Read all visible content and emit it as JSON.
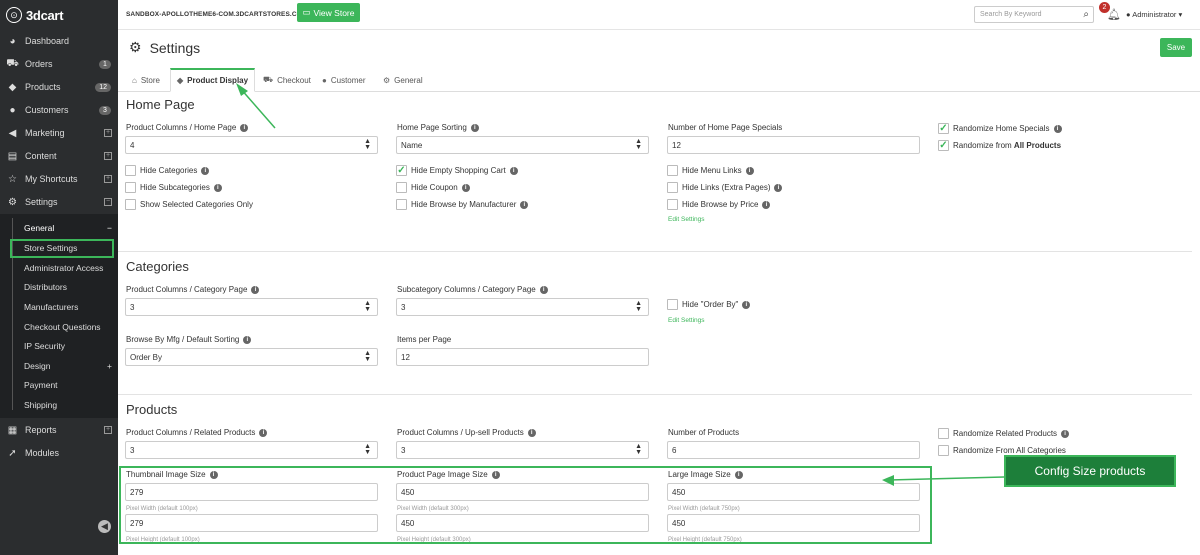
{
  "sidebar": {
    "logo_text": "3dcart",
    "items": [
      {
        "label": "Dashboard",
        "icon": "palette-icon"
      },
      {
        "label": "Orders",
        "icon": "cart-icon",
        "badge": "1"
      },
      {
        "label": "Products",
        "icon": "tag-icon",
        "badge": "12"
      },
      {
        "label": "Customers",
        "icon": "user-icon",
        "badge": "3"
      },
      {
        "label": "Marketing",
        "icon": "megaphone-icon"
      },
      {
        "label": "Content",
        "icon": "document-icon"
      },
      {
        "label": "My Shortcuts",
        "icon": "star-icon"
      },
      {
        "label": "Settings",
        "icon": "gear-icon"
      }
    ],
    "settings_sub": [
      "General",
      "Store Settings",
      "Administrator Access",
      "Distributors",
      "Manufacturers",
      "Checkout Questions",
      "IP Security",
      "Design",
      "Payment",
      "Shipping"
    ],
    "bottom_items": [
      {
        "label": "Reports",
        "icon": "chart-icon"
      },
      {
        "label": "Modules",
        "icon": "rocket-icon"
      }
    ]
  },
  "topbar": {
    "store_url": "SANDBOX-APOLLOTHEME6-COM.3DCARTSTORES.COM",
    "view_store": "View Store",
    "search_placeholder": "Search By Keyword",
    "notifications": "2",
    "user": "Administrator"
  },
  "page": {
    "title": "Settings",
    "save": "Save"
  },
  "tabs": [
    "Store",
    "Product Display",
    "Checkout",
    "Customer",
    "General"
  ],
  "home": {
    "title": "Home Page",
    "product_columns_label": "Product Columns / Home Page",
    "product_columns_value": "4",
    "sorting_label": "Home Page Sorting",
    "sorting_value": "Name",
    "specials_label": "Number of Home Page Specials",
    "specials_value": "12",
    "randomize_specials": "Randomize Home Specials",
    "randomize_from_prefix": "Randomize from ",
    "randomize_from_bold": "All Products",
    "hide_categories": "Hide Categories",
    "hide_subcategories": "Hide Subcategories",
    "show_selected": "Show Selected Categories Only",
    "hide_empty_cart": "Hide Empty Shopping Cart",
    "hide_coupon": "Hide Coupon",
    "hide_browse_mfr": "Hide Browse by Manufacturer",
    "hide_menu_links": "Hide Menu Links",
    "hide_links_extra": "Hide Links (Extra Pages)",
    "hide_browse_price": "Hide Browse by Price",
    "edit_settings": "Edit Settings"
  },
  "categories": {
    "title": "Categories",
    "cat_columns_label": "Product Columns / Category Page",
    "cat_columns_value": "3",
    "subcat_columns_label": "Subcategory Columns / Category Page",
    "subcat_columns_value": "3",
    "hide_order_by": "Hide \"Order By\"",
    "edit_settings": "Edit Settings",
    "browse_sort_label": "Browse By Mfg / Default Sorting",
    "browse_sort_value": "Order By",
    "items_per_page_label": "Items per Page",
    "items_per_page_value": "12"
  },
  "products": {
    "title": "Products",
    "related_label": "Product Columns / Related Products",
    "related_value": "3",
    "upsell_label": "Product Columns / Up-sell Products",
    "upsell_value": "3",
    "number_label": "Number of Products",
    "number_value": "6",
    "randomize_related": "Randomize Related Products",
    "randomize_all": "Randomize From All Categories",
    "thumb_label": "Thumbnail Image Size",
    "thumb_w": "279",
    "thumb_w_hint": "Pixel Width (default 100px)",
    "thumb_h": "279",
    "thumb_h_hint": "Pixel Height (default 100px)",
    "page_label": "Product Page Image Size",
    "page_w": "450",
    "page_w_hint": "Pixel Width (default 300px)",
    "page_h": "450",
    "page_h_hint": "Pixel Height (default 300px)",
    "large_label": "Large Image Size",
    "large_w": "450",
    "large_w_hint": "Pixel Width (default 750px)",
    "large_h": "450",
    "large_h_hint": "Pixel Height (default 750px)"
  },
  "callout": "Config Size products",
  "accent_color": "#3cb65a"
}
